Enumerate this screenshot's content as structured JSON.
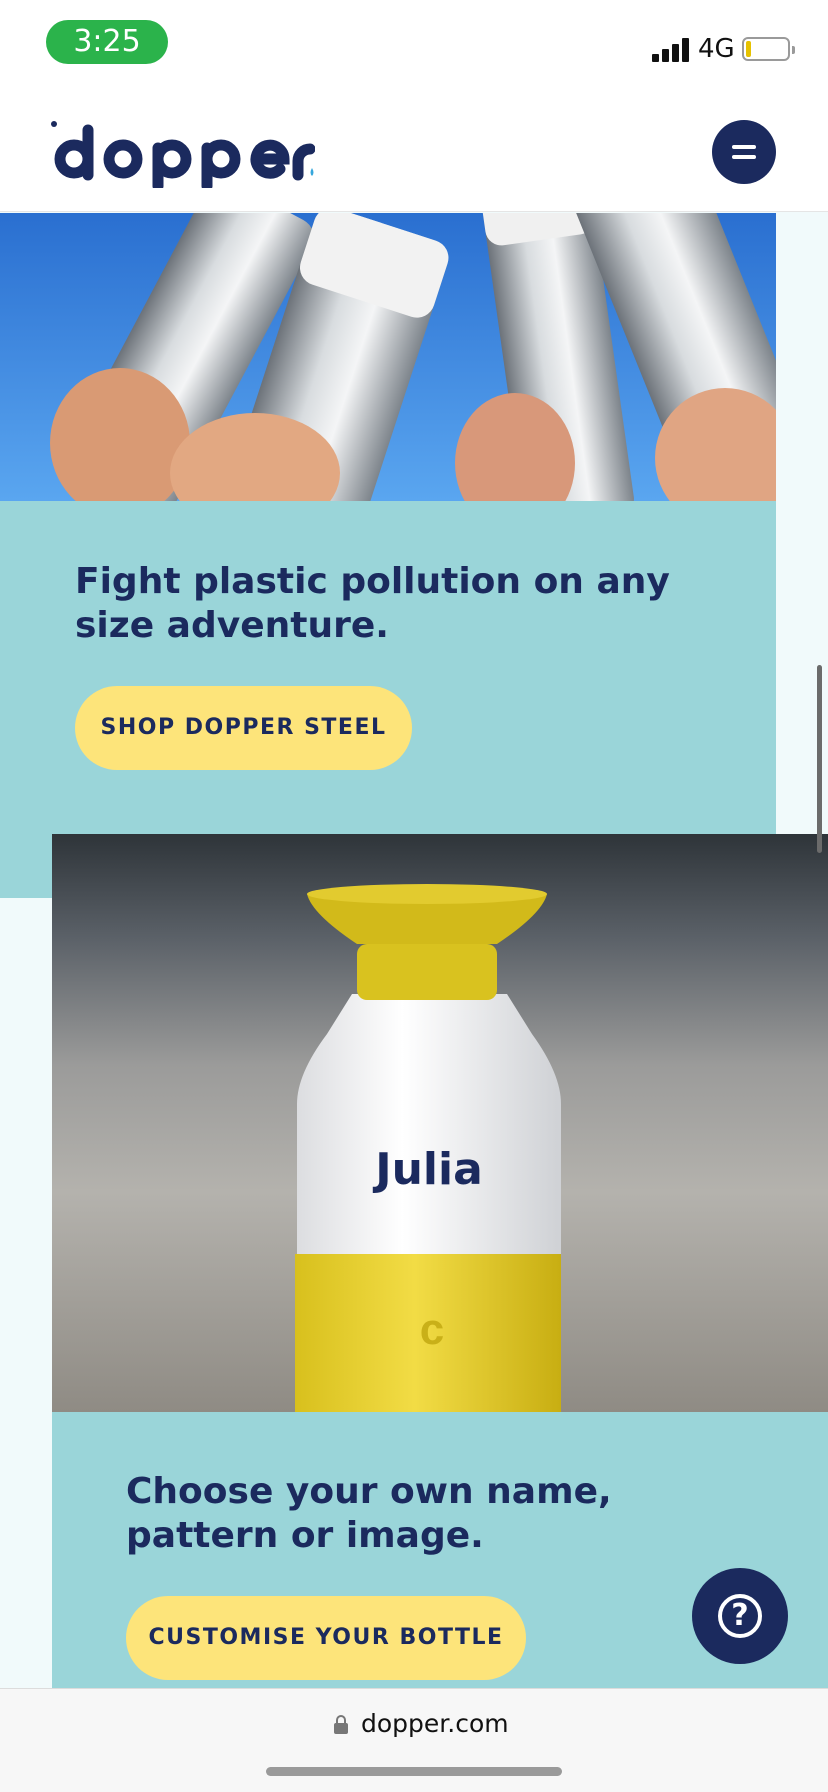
{
  "status_bar": {
    "time": "3:25",
    "network": "4G"
  },
  "header": {
    "logo_text": "dopper",
    "menu_icon": "hamburger-icon"
  },
  "sections": [
    {
      "image_icon": "steel-bottles-photo",
      "title": "Fight plastic pollution on any size adventure.",
      "button_label": "SHOP DOPPER STEEL"
    },
    {
      "image_icon": "personalised-bottle-photo",
      "bottle_name": "Julia",
      "title": "Choose your own name, pattern or image.",
      "button_label": "CUSTOMISE YOUR BOTTLE"
    }
  ],
  "help": {
    "icon": "question-icon",
    "label": "?"
  },
  "browser": {
    "url": "dopper.com"
  },
  "colors": {
    "navy": "#1b2a5e",
    "teal": "#9ad5d9",
    "yellow": "#fde47a",
    "status_green": "#2bb34b",
    "accent_drop": "#36a7dc"
  }
}
